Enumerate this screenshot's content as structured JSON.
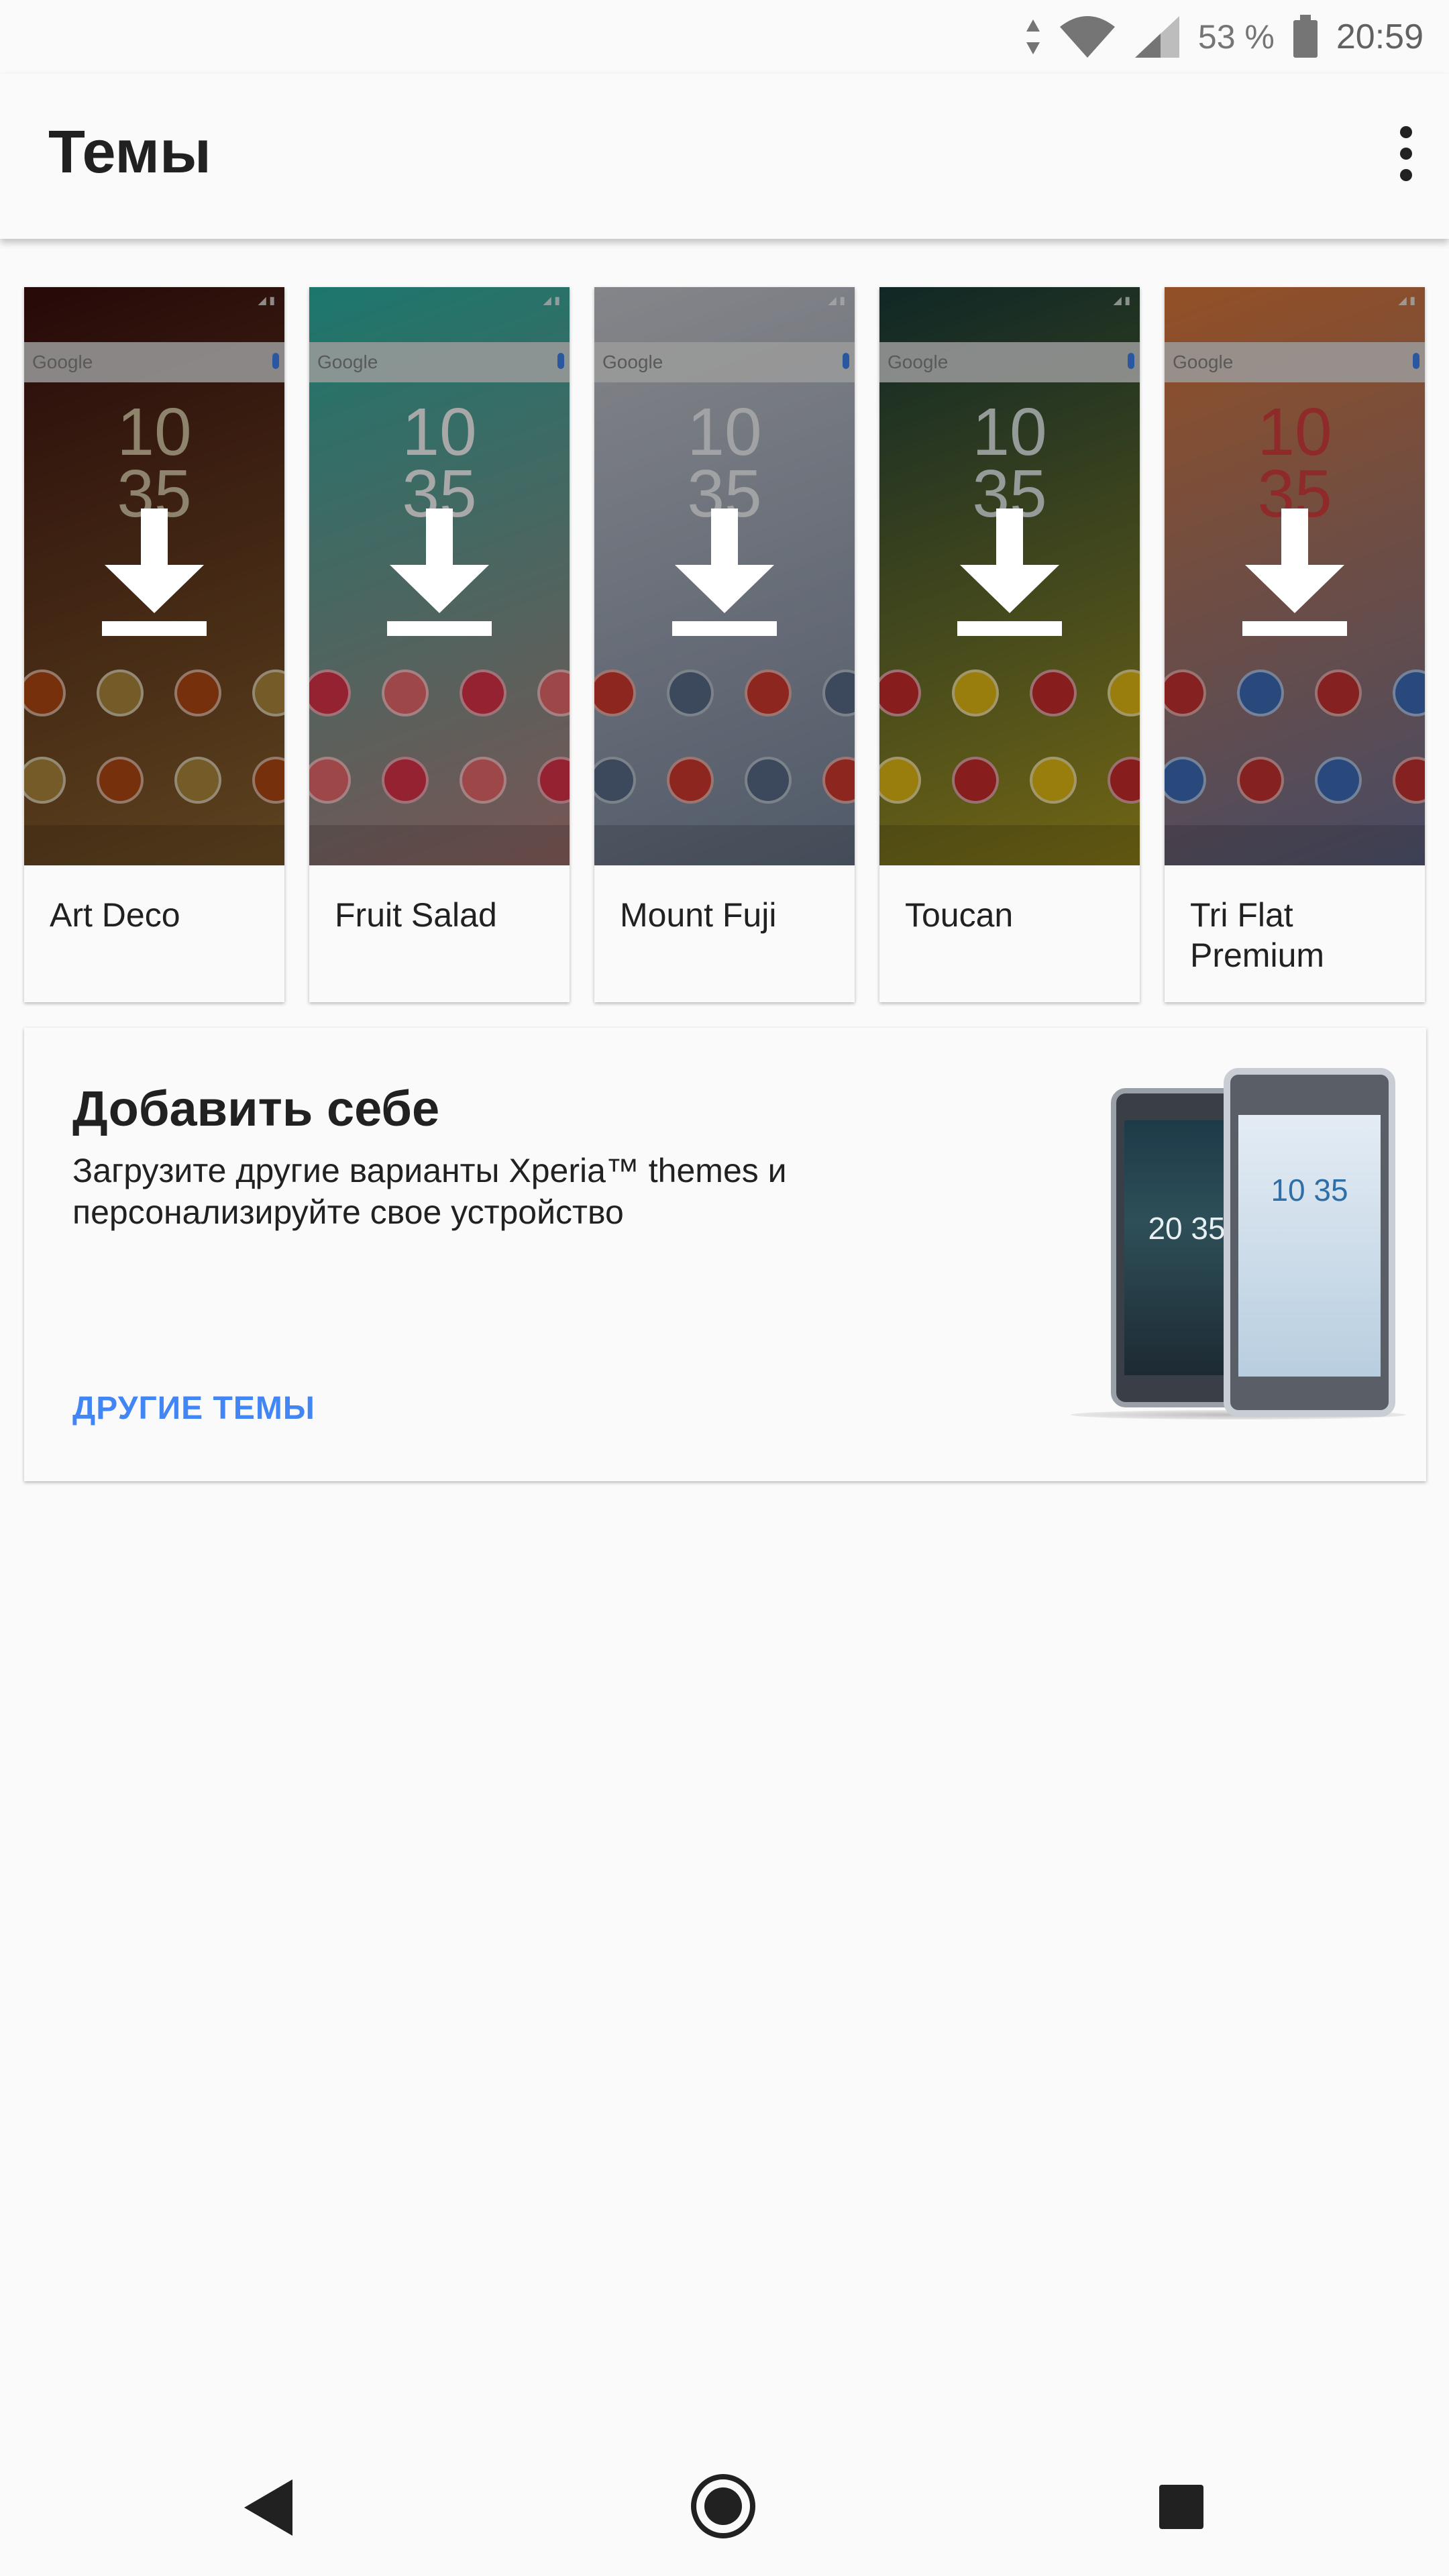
{
  "status_bar": {
    "battery_percent": "53 %",
    "time": "20:59"
  },
  "app_bar": {
    "title": "Темы"
  },
  "themes": [
    {
      "name": "Art Deco",
      "bg": "#3b0f0e",
      "accent": "#b08a3c",
      "clock_color": "#d8c7a6",
      "icon_color": "#b34a12"
    },
    {
      "name": "Fruit Salad",
      "bg": "#2bb5a6",
      "accent": "#f06d70",
      "clock_color": "#ffffff",
      "icon_color": "#e2344a"
    },
    {
      "name": "Mount Fuji",
      "bg": "#c9cbd2",
      "accent": "#5b6e8b",
      "clock_color": "#f5f6f8",
      "icon_color": "#d63a2f"
    },
    {
      "name": "Toucan",
      "bg": "#173c3a",
      "accent": "#e8c015",
      "clock_color": "#e2ece8",
      "icon_color": "#cf2c2c"
    },
    {
      "name": "Tri Flat Premium",
      "bg": "#e07a3a",
      "accent": "#3f6fbe",
      "clock_color": "#d84040",
      "icon_color": "#cc3333"
    }
  ],
  "theme_preview": {
    "google_text": "Google",
    "clock_hours": "10",
    "clock_minutes": "35"
  },
  "promo": {
    "title": "Добавить себе",
    "description": "Загрузите другие варианты Xperia™ themes и персонализируйте свое устройство",
    "link_label": "ДРУГИЕ ТЕМЫ",
    "link_color": "#4285f4",
    "phone_back_clock": "20 35",
    "phone_front_clock": "10 35"
  }
}
